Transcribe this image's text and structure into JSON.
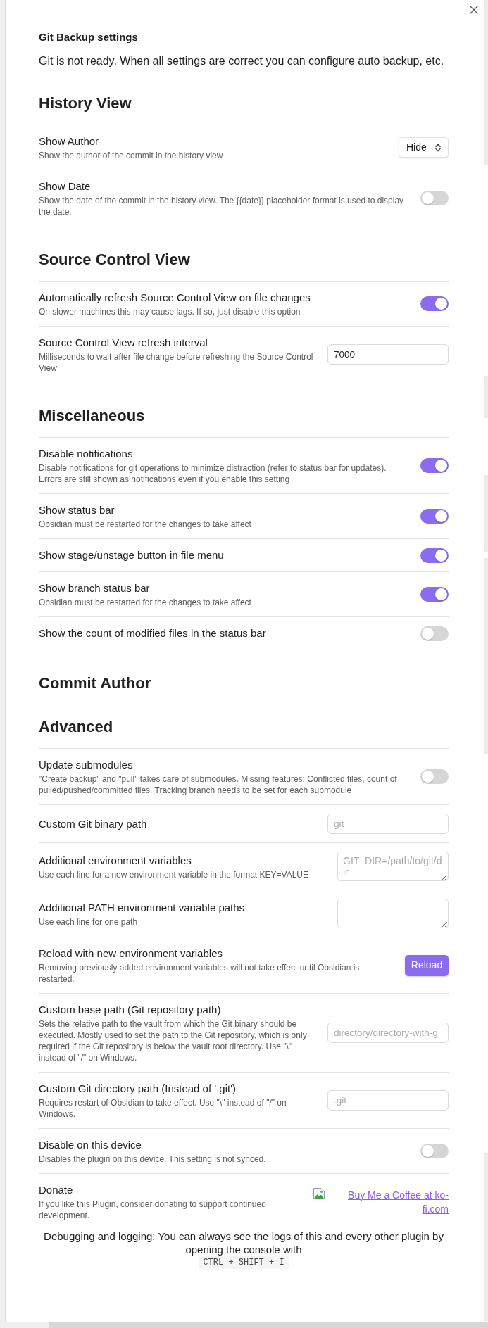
{
  "header": {
    "title": "Git Backup settings",
    "status": "Git is not ready. When all settings are correct you can configure auto backup, etc."
  },
  "sections": [
    {
      "heading": "History View",
      "settings": [
        {
          "kind": "dropdown",
          "name": "Show Author",
          "description": "Show the author of the commit in the history view",
          "value": "Hide"
        },
        {
          "kind": "toggle",
          "name": "Show Date",
          "description": "Show the date of the commit in the history view. The {{date}} placeholder format is used to display the date.",
          "on": false
        }
      ]
    },
    {
      "heading": "Source Control View",
      "settings": [
        {
          "kind": "toggle",
          "name": "Automatically refresh Source Control View on file changes",
          "description": "On slower machines this may cause lags. If so, just disable this option",
          "on": true
        },
        {
          "kind": "text",
          "name": "Source Control View refresh interval",
          "description": "Milliseconds to wait after file change before refreshing the Source Control View",
          "value": "7000"
        }
      ]
    },
    {
      "heading": "Miscellaneous",
      "settings": [
        {
          "kind": "toggle",
          "name": "Disable notifications",
          "description": "Disable notifications for git operations to minimize distraction (refer to status bar for updates). Errors are still shown as notifications even if you enable this setting",
          "on": true
        },
        {
          "kind": "toggle",
          "name": "Show status bar",
          "description": "Obsidian must be restarted for the changes to take affect",
          "on": true
        },
        {
          "kind": "toggle",
          "name": "Show stage/unstage button in file menu",
          "on": true
        },
        {
          "kind": "toggle",
          "name": "Show branch status bar",
          "description": "Obsidian must be restarted for the changes to take affect",
          "on": true
        },
        {
          "kind": "toggle",
          "name": "Show the count of modified files in the status bar",
          "on": false
        }
      ]
    },
    {
      "heading": "Commit Author"
    },
    {
      "heading": "Advanced",
      "settings": [
        {
          "kind": "toggle",
          "name": "Update submodules",
          "description": "\"Create backup\" and \"pull\" takes care of submodules. Missing features: Conflicted files, count of pulled/pushed/committed files. Tracking branch needs to be set for each submodule",
          "on": false
        },
        {
          "kind": "text",
          "name": "Custom Git binary path",
          "placeholder": "git"
        },
        {
          "kind": "textarea",
          "name": "Additional environment variables",
          "description": "Use each line for a new environment variable in the format KEY=VALUE",
          "placeholder": "GIT_DIR=/path/to/git/dir"
        },
        {
          "kind": "textarea",
          "name": "Additional PATH environment variable paths",
          "description": "Use each line for one path"
        },
        {
          "kind": "button",
          "name": "Reload with new environment variables",
          "description": "Removing previously added environment variables will not take effect until Obsidian is restarted.",
          "label": "Reload"
        },
        {
          "kind": "text",
          "name": "Custom base path (Git repository path)",
          "description": "Sets the relative path to the vault from which the Git binary should be executed. Mostly used to set the path to the Git repository, which is only required if the Git repository is below the vault root directory. Use \"\\\" instead of \"/\" on Windows.",
          "placeholder": "directory/directory-with-g"
        },
        {
          "kind": "text",
          "name": "Custom Git directory path (Instead of '.git')",
          "description": "Requires restart of Obsidian to take effect. Use \"\\\" instead of \"/\" on Windows.",
          "placeholder": ".git"
        },
        {
          "kind": "toggle",
          "name": "Disable on this device",
          "description": "Disables the plugin on this device. This setting is not synced.",
          "on": false
        },
        {
          "kind": "link",
          "name": "Donate",
          "description": "If you like this Plugin, consider donating to support continued development.",
          "label": "Buy Me a Coffee at ko-fi.com"
        }
      ]
    }
  ],
  "footer": {
    "text": "Debugging and logging: You can always see the logs of this and every other plugin by opening the console with",
    "shortcut": "CTRL + SHIFT + I"
  }
}
